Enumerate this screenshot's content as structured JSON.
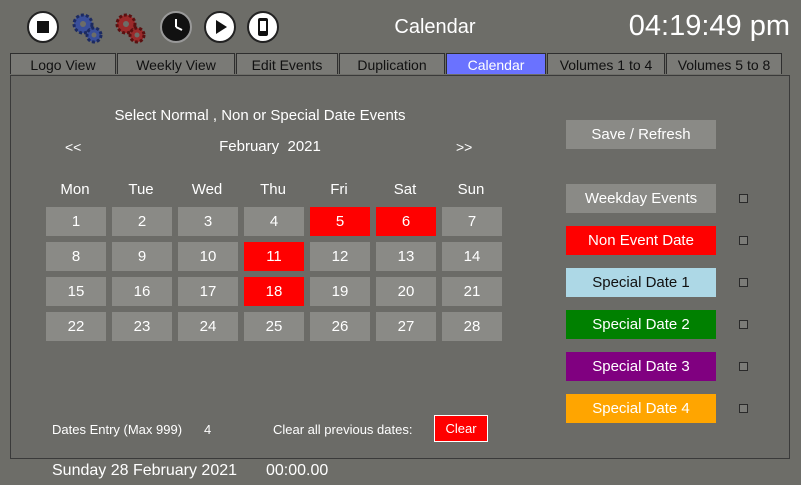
{
  "header": {
    "title": "Calendar",
    "clock": "04:19:49 pm",
    "icons": [
      "stop-icon",
      "gear-blue-icon",
      "gear-red-icon",
      "clock-icon",
      "play-icon",
      "phone-icon"
    ]
  },
  "tabs": [
    {
      "label": "Logo View",
      "active": false
    },
    {
      "label": "Weekly View",
      "active": false
    },
    {
      "label": "Edit Events",
      "active": false
    },
    {
      "label": "Duplication",
      "active": false
    },
    {
      "label": "Calendar",
      "active": true
    },
    {
      "label": "Volumes 1 to 4",
      "active": false
    },
    {
      "label": "Volumes 5 to 8",
      "active": false
    }
  ],
  "calendar": {
    "heading": "Select Normal , Non or Special Date Events",
    "prev": "<<",
    "next": ">>",
    "month_label": "February  2021",
    "weekdays": [
      "Mon",
      "Tue",
      "Wed",
      "Thu",
      "Fri",
      "Sat",
      "Sun"
    ],
    "weeks": [
      [
        "1",
        "2",
        "3",
        "4",
        "5",
        "6",
        "7"
      ],
      [
        "8",
        "9",
        "10",
        "11",
        "12",
        "13",
        "14"
      ],
      [
        "15",
        "16",
        "17",
        "18",
        "19",
        "20",
        "21"
      ],
      [
        "22",
        "23",
        "24",
        "25",
        "26",
        "27",
        "28"
      ]
    ],
    "non_event_days": [
      "5",
      "6",
      "11",
      "18"
    ],
    "non_event_color": "#ff0000",
    "normal_color": "#8a8a86"
  },
  "actions": {
    "save_refresh": "Save / Refresh",
    "event_types": [
      {
        "label": "Weekday Events",
        "bg": "#8a8a86",
        "fg": "#ffffff"
      },
      {
        "label": "Non Event Date",
        "bg": "#ff0000",
        "fg": "#ffffff"
      },
      {
        "label": "Special Date 1",
        "bg": "#add8e6",
        "fg": "#111111"
      },
      {
        "label": "Special Date 2",
        "bg": "#008000",
        "fg": "#ffffff"
      },
      {
        "label": "Special Date 3",
        "bg": "#800080",
        "fg": "#ffffff"
      },
      {
        "label": "Special Date 4",
        "bg": "#ffa500",
        "fg": "#ffffff"
      }
    ]
  },
  "bottom": {
    "dates_entry_label": "Dates Entry (Max 999)",
    "dates_entry_value": "4",
    "clear_label": "Clear all previous dates:",
    "clear_button": "Clear"
  },
  "footer": {
    "date": "Sunday 28 February 2021",
    "time": "00:00.00"
  }
}
